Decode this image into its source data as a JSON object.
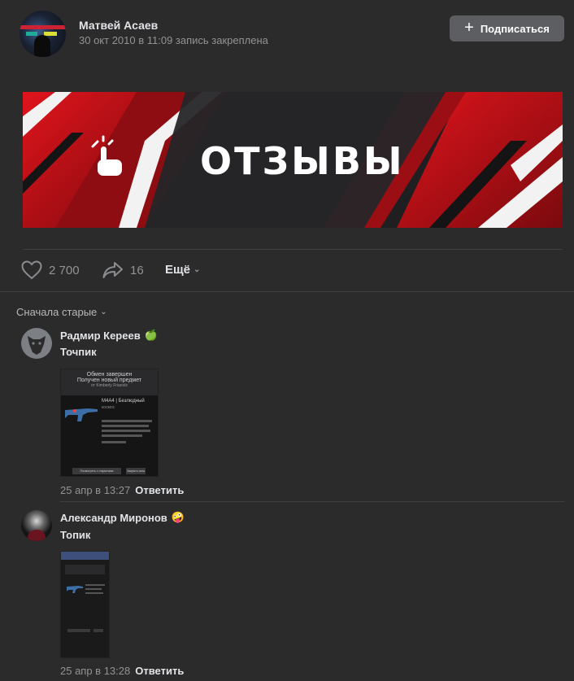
{
  "post": {
    "author": "Матвей Асаев",
    "meta": "30 окт 2010 в 11:09 запись закреплена",
    "subscribe_label": "Подписаться",
    "banner_text": "ОТЗЫВЫ",
    "likes": "2 700",
    "shares": "16",
    "more_label": "Ещё"
  },
  "comments_sort": "Сначала старые",
  "comments": [
    {
      "author": "Радмир Кереев",
      "emoji": "🍏",
      "text": "Точпик",
      "date": "25 апр в 13:27",
      "reply_label": "Ответить",
      "shot": {
        "line1": "Обмен завершен",
        "line2": "Получен новый предмет",
        "line3": "от Kimberly Frianolz",
        "item_title": "M4A4 | Безлюдный",
        "item_sub": "космос",
        "btn1": "Посмотреть с открытыми помощника",
        "btn2": "Закрыть окна"
      }
    },
    {
      "author": "Александр Миронов",
      "emoji": "🤪",
      "text": "Топик",
      "date": "25 апр в 13:28",
      "reply_label": "Ответить"
    }
  ],
  "colors": {
    "accent_red": "#c4121a",
    "background": "#2b2b2c"
  }
}
